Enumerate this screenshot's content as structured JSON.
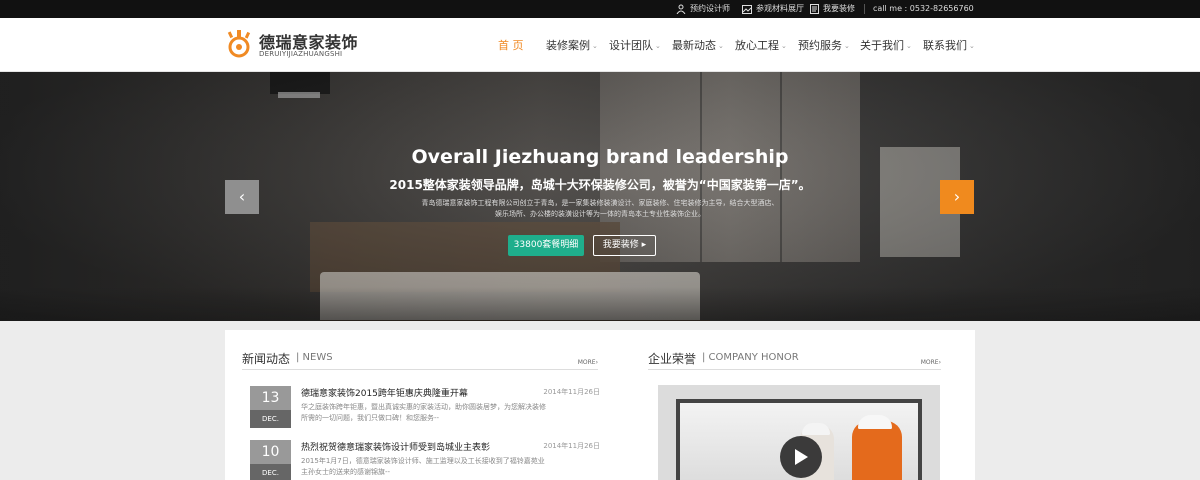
{
  "topbar": {
    "links": [
      {
        "label": "预约设计师",
        "icon": "person-icon"
      },
      {
        "label": "参观材料展厅",
        "icon": "image-icon"
      },
      {
        "label": "我要装修",
        "icon": "document-icon"
      }
    ],
    "contact": "call me : 0532-82656760"
  },
  "logo": {
    "cn": "德瑞意家装饰",
    "en": "DERUIYIJIAZHUANGSHI"
  },
  "nav": {
    "items": [
      {
        "label": "首 页",
        "active": true,
        "has_dropdown": false
      },
      {
        "label": "装修案例",
        "active": false,
        "has_dropdown": true
      },
      {
        "label": "设计团队",
        "active": false,
        "has_dropdown": true
      },
      {
        "label": "最新动态",
        "active": false,
        "has_dropdown": true
      },
      {
        "label": "放心工程",
        "active": false,
        "has_dropdown": true
      },
      {
        "label": "预约服务",
        "active": false,
        "has_dropdown": true
      },
      {
        "label": "关于我们",
        "active": false,
        "has_dropdown": true
      },
      {
        "label": "联系我们",
        "active": false,
        "has_dropdown": true
      }
    ]
  },
  "hero": {
    "title": "Overall Jiezhuang brand leadership",
    "subtitle": "2015整体家装领导品牌，岛城十大环保装修公司，被誉为“中国家装第一店”。",
    "description": "青岛德瑞意家装饰工程有限公司创立于青岛，是一家集装修装潢设计、家庭装修、住宅装修为主导，结合大型酒店、娱乐场所、办公楼的装潢设计等为一体的青岛本土专业性装饰企业。",
    "btn_primary": "33800套餐明细",
    "btn_secondary": "我要装修 ▸",
    "prev_arrow": "‹",
    "next_arrow": "›"
  },
  "news": {
    "title_cn": "新闻动态",
    "title_en": "| NEWS",
    "more": "MORE›",
    "items": [
      {
        "day": "13",
        "month": "DEC.",
        "title": "德瑞意家装饰2015跨年钜惠庆典隆重开幕",
        "date": "2014年11月26日",
        "excerpt": "华之庭装饰跨年钜惠，暨出真诚实惠的家装活动，助你圆装居梦，为您解决装修所需的一切问题，我们只做口碑！和您服务--"
      },
      {
        "day": "10",
        "month": "DEC.",
        "title": "热烈祝贺德意瑞家装饰设计师受到岛城业主表彰",
        "date": "2014年11月26日",
        "excerpt": "2015年1月7日，德意瑞家装饰设计师、施工监理以及工长接收到了福铃嘉苑业主孙女士的送来的感谢锦旗--"
      }
    ]
  },
  "honor": {
    "title_cn": "企业荣誉",
    "title_en": "| COMPANY HONOR",
    "more": "MORE›"
  },
  "colors": {
    "accent": "#f08a24",
    "green_button": "#1fae8c",
    "topbar_bg": "#111111"
  }
}
